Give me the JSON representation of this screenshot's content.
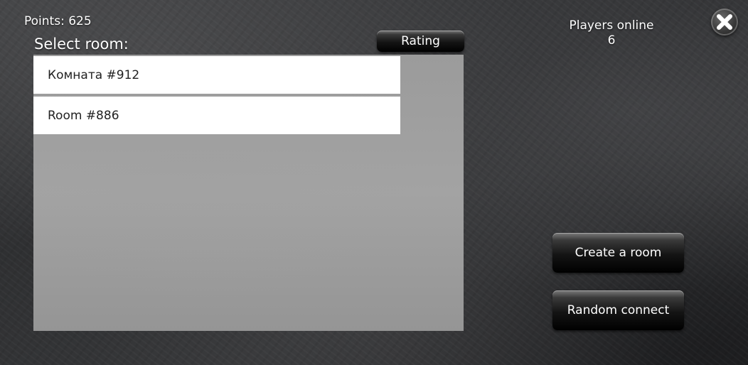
{
  "hud": {
    "points": "Points: 625",
    "select_room_label": "Select room:",
    "players_online_label": "Players online",
    "players_online_count": "6"
  },
  "buttons": {
    "rating": "Rating",
    "create_room": "Create a room",
    "random_connect": "Random connect"
  },
  "close": {
    "icon": "close-icon"
  },
  "rooms": [
    {
      "label": "Комната #912"
    },
    {
      "label": "Room #886"
    }
  ]
}
